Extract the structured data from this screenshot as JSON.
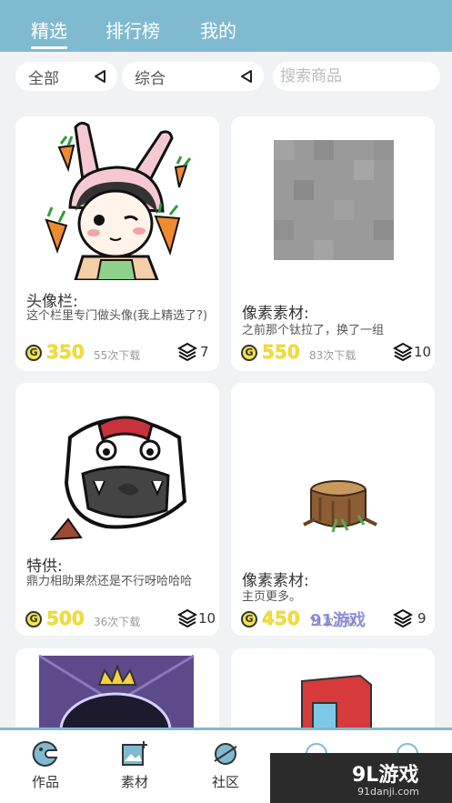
{
  "tabs": [
    "精选",
    "排行榜",
    "我的"
  ],
  "filters": {
    "category": "全部",
    "sort": "综合",
    "search_placeholder": "搜索商品"
  },
  "cards": [
    {
      "title": "头像栏:",
      "desc": "这个栏里专门做头像(我上精选了?)",
      "coin_label": "G",
      "price": "350",
      "downloads": "55次下载",
      "count": "7"
    },
    {
      "title": "像素素材:",
      "desc": "之前那个钛拉了，换了一组",
      "coin_label": "G",
      "price": "550",
      "downloads": "83次下载",
      "count": "10"
    },
    {
      "title": "特供:",
      "desc": "鼎力相助果然还是不行呀哈哈哈",
      "coin_label": "G",
      "price": "500",
      "downloads": "36次下载",
      "count": "10"
    },
    {
      "title": "像素素材:",
      "desc": "主页更多。",
      "coin_label": "G",
      "price": "450",
      "downloads": "71次下载",
      "count": "9"
    }
  ],
  "bottom_nav": [
    "作品",
    "素材",
    "社区",
    "",
    ""
  ],
  "watermark": {
    "mid": "91游戏",
    "corner_big": "9L游戏",
    "corner_small": "91danji.com"
  },
  "colors": {
    "header": "#7fbad1",
    "background": "#f1f2f4",
    "price": "#f0df3a",
    "coin": "#f4e34a"
  }
}
